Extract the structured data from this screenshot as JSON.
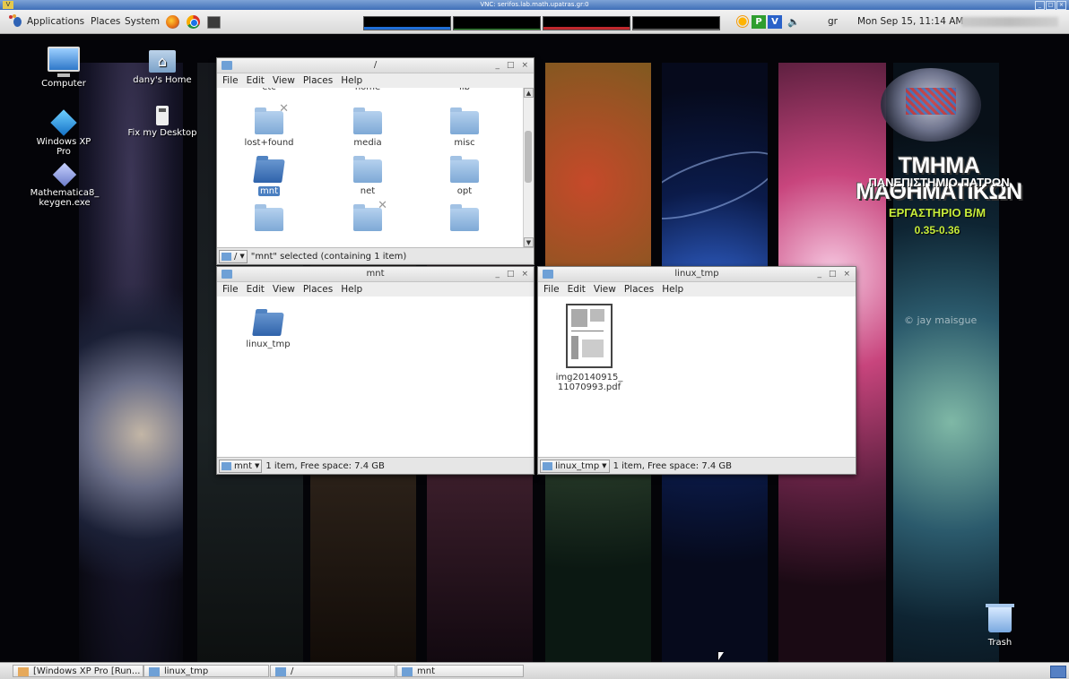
{
  "vnc": {
    "title": "VNC: serifos.lab.math.upatras.gr:0"
  },
  "top_panel": {
    "menus": [
      "Applications",
      "Places",
      "System"
    ],
    "keyboard_layout": "gr",
    "clock": "Mon Sep 15, 11:14 AM",
    "tray": {
      "p_label": "P",
      "v_label": "V"
    }
  },
  "desktop": {
    "icons": [
      {
        "label": "Computer"
      },
      {
        "label": "dany's Home"
      },
      {
        "label": "Windows XP Pro"
      },
      {
        "label": "Fix my Desktop"
      },
      {
        "label": "Mathematica8_ keygen.exe"
      },
      {
        "label": "Trash"
      }
    ],
    "wallpaper": {
      "title": "ΤΜΗΜΑ ΜΑΘΗΜΑΤΙΚΩΝ",
      "subtitle": "ΠΑΝΕΠΙΣΤΗΜΙΟ ΠΑΤΡΩΝ",
      "lab": "ΕΡΓΑΣΤΗΡΙΟ Β/Μ",
      "version": "0.35-0.36",
      "credit": "© jay maisgue"
    }
  },
  "windows": {
    "root": {
      "title": "/",
      "menu": [
        "File",
        "Edit",
        "View",
        "Places",
        "Help"
      ],
      "items": [
        {
          "label": "etc"
        },
        {
          "label": "home"
        },
        {
          "label": "lib"
        },
        {
          "label": "lost+found"
        },
        {
          "label": "media"
        },
        {
          "label": "misc"
        },
        {
          "label": "mnt"
        },
        {
          "label": "net"
        },
        {
          "label": "opt"
        }
      ],
      "path": "/",
      "status": "\"mnt\" selected (containing 1 item)"
    },
    "mnt": {
      "title": "mnt",
      "menu": [
        "File",
        "Edit",
        "View",
        "Places",
        "Help"
      ],
      "items": [
        {
          "label": "linux_tmp"
        }
      ],
      "path": "mnt",
      "status": "1 item, Free space: 7.4 GB"
    },
    "linux_tmp": {
      "title": "linux_tmp",
      "menu": [
        "File",
        "Edit",
        "View",
        "Places",
        "Help"
      ],
      "items": [
        {
          "label": "img20140915_ 11070993.pdf"
        }
      ],
      "path": "linux_tmp",
      "status": "1 item, Free space: 7.4 GB"
    }
  },
  "taskbar": {
    "tasks": [
      {
        "label": "[Windows XP Pro [Run..."
      },
      {
        "label": "linux_tmp"
      },
      {
        "label": "/"
      },
      {
        "label": "mnt"
      }
    ]
  },
  "colors": {
    "panel": "#dcdcdc",
    "folder": "#8fb4dd",
    "selection": "#4a7fc1",
    "wallpaper_accent": "#c7ec3a"
  }
}
